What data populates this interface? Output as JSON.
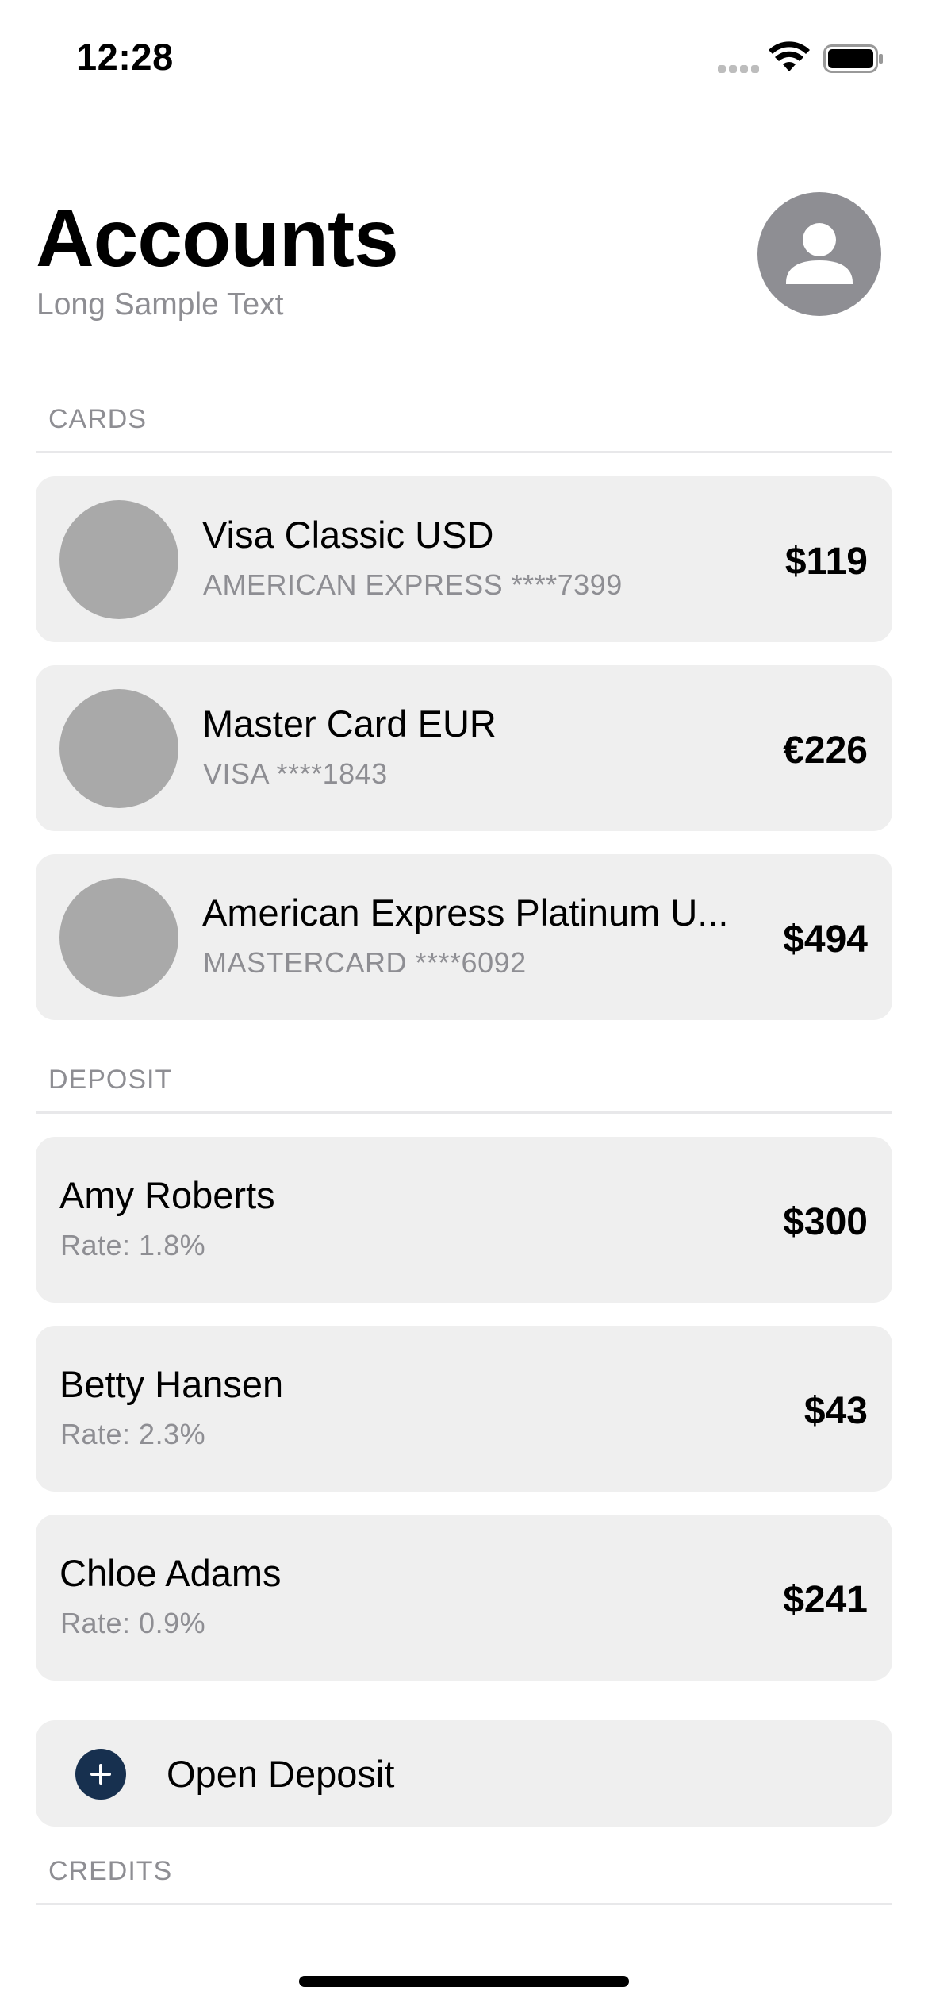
{
  "status_bar": {
    "time": "12:28"
  },
  "header": {
    "title": "Accounts",
    "subtitle": "Long Sample Text",
    "avatar_icon": "person-icon"
  },
  "sections": {
    "cards": {
      "header": "CARDS",
      "items": [
        {
          "name": "Visa Classic USD",
          "sub": "AMERICAN EXPRESS ****7399",
          "amount": "$119"
        },
        {
          "name": "Master Card EUR",
          "sub": "VISA ****1843",
          "amount": "€226"
        },
        {
          "name": "American Express Platinum U...",
          "sub": "MASTERCARD ****6092",
          "amount": "$494"
        }
      ]
    },
    "deposit": {
      "header": "DEPOSIT",
      "items": [
        {
          "name": "Amy Roberts",
          "rate": "Rate: 1.8%",
          "amount": "$300"
        },
        {
          "name": "Betty Hansen",
          "rate": "Rate: 2.3%",
          "amount": "$43"
        },
        {
          "name": "Chloe Adams",
          "rate": "Rate: 0.9%",
          "amount": "$241"
        }
      ],
      "open_label": "Open Deposit"
    },
    "credits": {
      "header": "CREDITS"
    }
  },
  "colors": {
    "accent": "#17304f",
    "secondary_text": "#8e8e93",
    "card_background": "#efefef",
    "thumbnail": "#a9a9a9"
  }
}
